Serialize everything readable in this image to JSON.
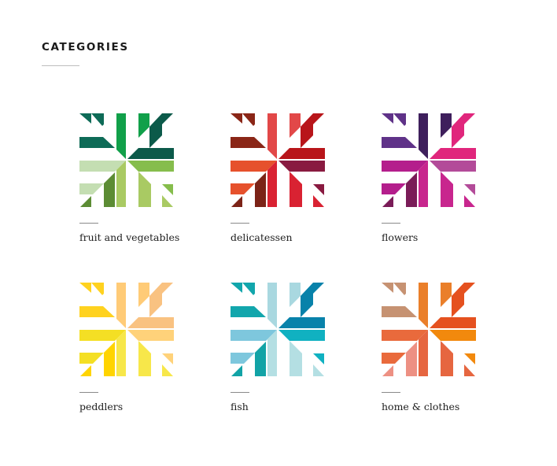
{
  "header": {
    "title": "CATEGORIES"
  },
  "categories": [
    {
      "label": "fruit and vegetables",
      "icon": "fruit-vegetables-icon",
      "colors": [
        "#0e6b57",
        "#11a04a",
        "#0c5a4a",
        "#c4deb2",
        "#5c8c34",
        "#a9ca63",
        "#86bd4c"
      ]
    },
    {
      "label": "delicatessen",
      "icon": "delicatessen-icon",
      "colors": [
        "#8a2617",
        "#e24848",
        "#b8151a",
        "#e6512c",
        "#7c2317",
        "#d92232",
        "#891a40"
      ]
    },
    {
      "label": "flowers",
      "icon": "flowers-icon",
      "colors": [
        "#5f3288",
        "#3e1f5c",
        "#e0267c",
        "#b41e8c",
        "#7a1c58",
        "#c8268e",
        "#b34b99"
      ]
    },
    {
      "label": "peddlers",
      "icon": "peddlers-icon",
      "colors": [
        "#ffd21f",
        "#ffcb77",
        "#f9c281",
        "#f4df24",
        "#ffd400",
        "#f7e74a",
        "#ffd27a"
      ]
    },
    {
      "label": "fish",
      "icon": "fish-icon",
      "colors": [
        "#12a6ac",
        "#a9d8e0",
        "#0882aa",
        "#7ec7dd",
        "#12a3a6",
        "#b4dfe3",
        "#10b1c1"
      ]
    },
    {
      "label": "home & clothes",
      "icon": "home-clothes-icon",
      "colors": [
        "#c69272",
        "#ea7f2a",
        "#e5511f",
        "#e96a3c",
        "#ed9083",
        "#e66640",
        "#f2890d"
      ]
    }
  ]
}
